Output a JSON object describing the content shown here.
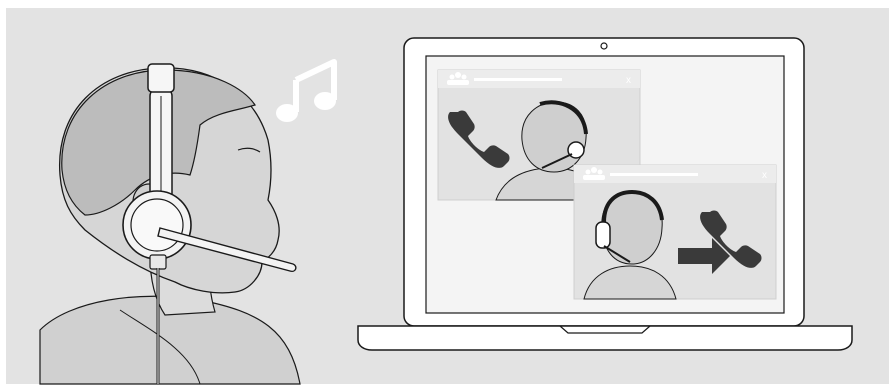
{
  "illustration": {
    "background_color": "#e3e3e3",
    "line_color": "#1a1a1a",
    "person_fill": "#d4d4d4",
    "hair_fill": "#bdbdbd",
    "screen_fill": "#f4f4f4",
    "window_fill": "#e2e2e2",
    "window_titlebar_fill": "#ececec",
    "icon_color": "#3a3a3a"
  },
  "call_window_top": {
    "close_label": "x",
    "left_icon": "phone-hang-up-icon",
    "person": "caller-with-headset"
  },
  "call_window_bottom": {
    "close_label": "x",
    "right_icon": "phone-incoming-arrow-icon",
    "person": "caller-with-headset"
  },
  "music_icon": "music-notes-icon"
}
